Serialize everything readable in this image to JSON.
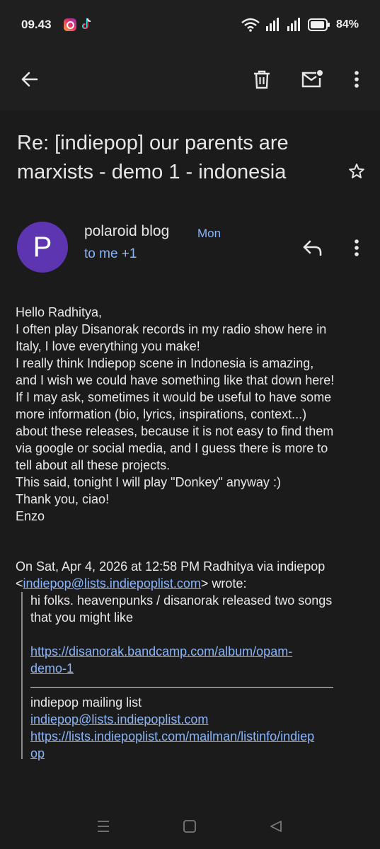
{
  "status_bar": {
    "time": "09.43",
    "battery": "84%",
    "notification_icons": [
      "instagram-icon",
      "tiktok-icon"
    ],
    "system_icons": [
      "wifi-icon",
      "signal-icon",
      "signal-icon",
      "battery-icon"
    ]
  },
  "toolbar": {
    "icons": [
      "back-arrow-icon",
      "trash-icon",
      "mark-unread-icon",
      "more-vert-icon"
    ]
  },
  "email": {
    "subject_line1": "Re: [indiepop] our parents are",
    "subject_line2": "marxists - demo 1 - indonesia",
    "sender": {
      "initial": "P",
      "name": "polaroid blog",
      "date": "Mon",
      "recipients": "to me +1",
      "avatar_color": "#5e35b1"
    },
    "body_lines": [
      "Hello Radhitya,",
      "I often play Disanorak records in my radio show here in",
      "Italy, I love everything you make!",
      "I really think Indiepop scene in Indonesia is amazing,",
      "and I wish we could have something like that down here!",
      "If I may ask, sometimes it would be useful to have some",
      "more information (bio, lyrics, inspirations, context...)",
      "about these releases, because it is not easy to find them",
      "via google or social media, and I guess there is more to",
      "tell about all these projects.",
      "This said, tonight I will play \"Donkey\" anyway :)",
      "Thank you, ciao!",
      "Enzo"
    ],
    "quote_header_line1": "On Sat, Apr 4, 2026 at 12:58 PM Radhitya via indiepop",
    "quote_header_lt": "<",
    "quote_header_email": "indiepop@lists.indiepoplist.com",
    "quote_header_gt": "> wrote:",
    "quoted": {
      "line1": "hi folks. heavenpunks / disanorak released two songs",
      "line2": "that you might like",
      "link1_line1": "https://disanorak.bandcamp.com/album/opam-",
      "link1_line2": "demo-1",
      "list_name": "indiepop mailing list",
      "list_email": "indiepop@lists.indiepoplist.com",
      "list_url_line1": "https://lists.indiepoplist.com/mailman/listinfo/indiep",
      "list_url_line2": "op"
    }
  },
  "nav_bar": {
    "icons": [
      "recents-icon",
      "home-icon",
      "back-icon"
    ]
  }
}
